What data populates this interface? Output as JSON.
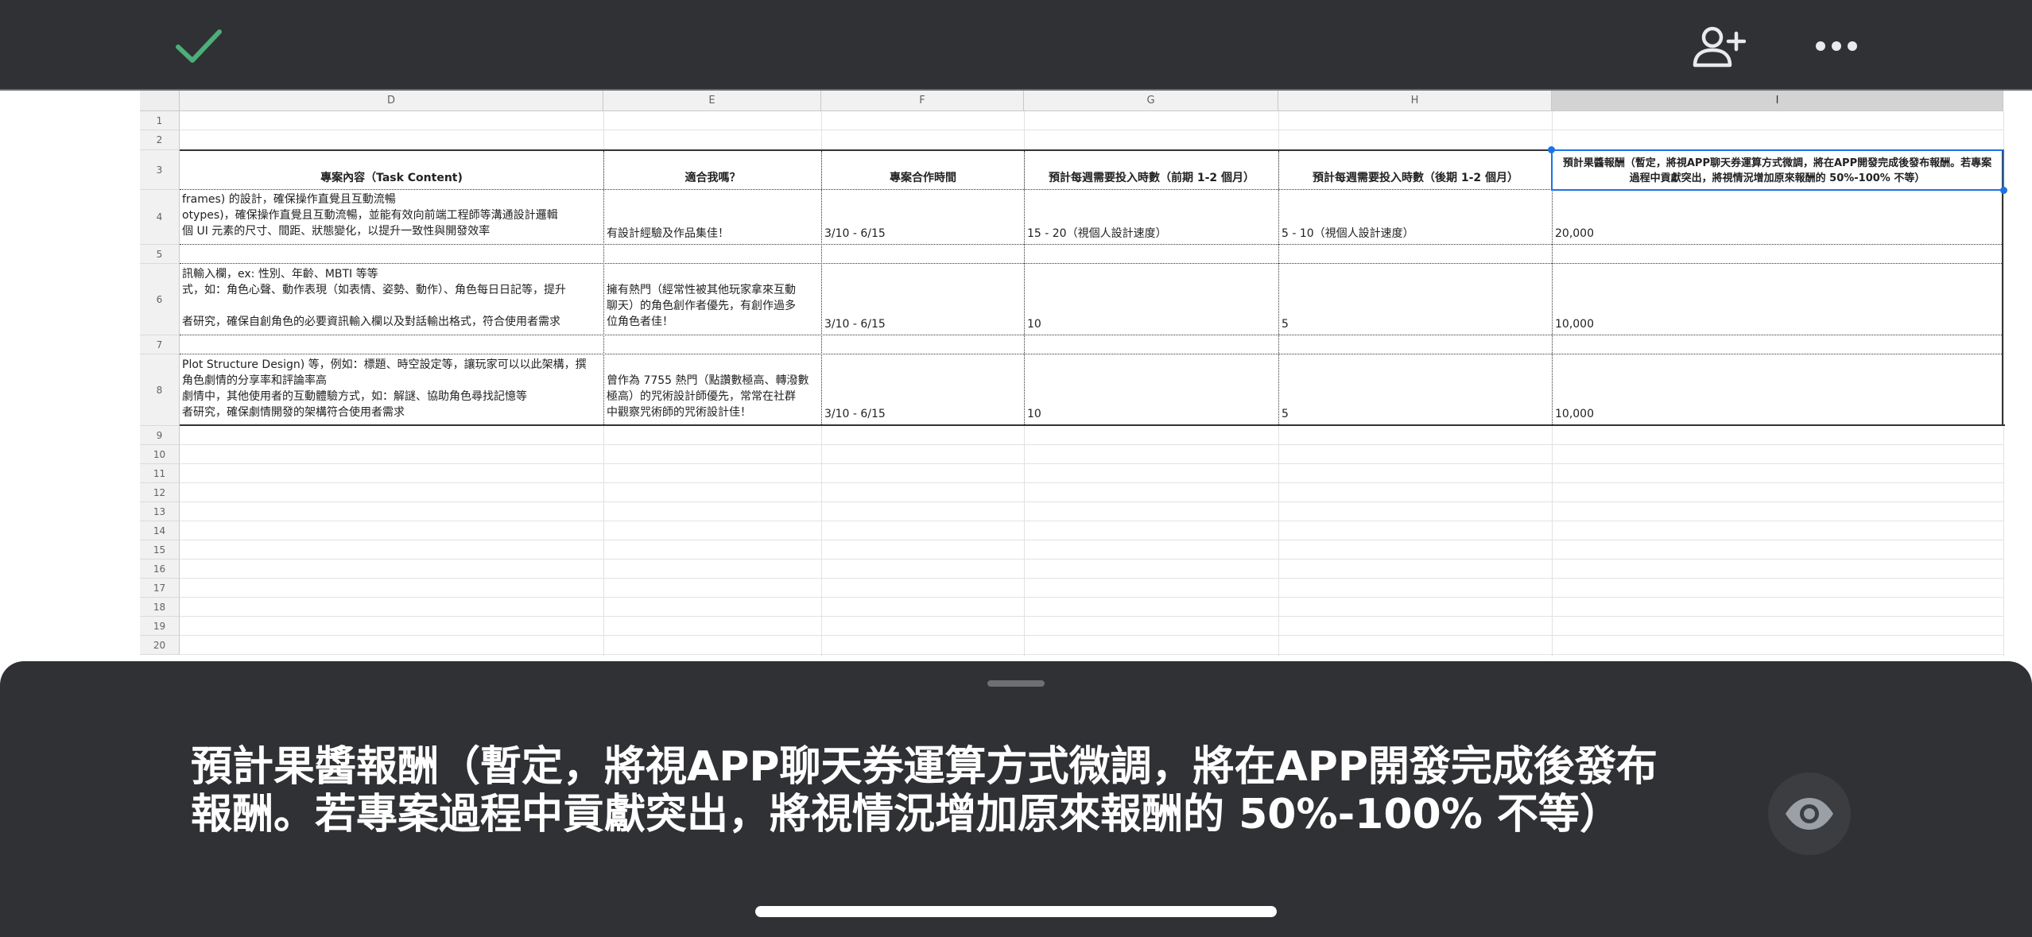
{
  "toolbar": {
    "check_icon": "check-icon",
    "add_user_icon": "person-add-icon",
    "more_icon": "more-horiz-icon"
  },
  "spreadsheet": {
    "columns": [
      "D",
      "E",
      "F",
      "G",
      "H",
      "I"
    ],
    "rows": [
      "1",
      "2",
      "3",
      "4",
      "5",
      "6",
      "7",
      "8",
      "9",
      "10",
      "11",
      "12",
      "13",
      "14",
      "15",
      "16",
      "17",
      "18",
      "19",
      "20"
    ],
    "header_row": {
      "d": "專案內容（Task Content)",
      "e": "適合我嗎？",
      "f": "專案合作時間",
      "g": "預計每週需要投入時數（前期 1-2 個月）",
      "h": "預計每週需要投入時數（後期 1-2 個月）",
      "i": "預計果醬報酬（暫定，將視APP聊天券運算方式微調，將在APP開發完成後發布報酬。若專案過程中貢獻突出，將視情況增加原來報酬的 50%-100% 不等）"
    },
    "row4": {
      "d": [
        "frames) 的設計，確保操作直覺且互動流暢",
        "otypes)，確保操作直覺且互動流暢，並能有效向前端工程師等溝通設計邏輯",
        "個 UI 元素的尺寸、間距、狀態變化，以提升一致性與開發效率"
      ],
      "e": "有設計經驗及作品集佳！",
      "f": "3/10 - 6/15",
      "g": "15 - 20（視個人設計速度）",
      "h": "5 - 10（視個人設計速度）",
      "i": "20,000"
    },
    "row6": {
      "d": [
        "訊輸入欄，ex: 性別、年齡、MBTI 等等",
        "式，如：角色心聲、動作表現（如表情、姿勢、動作）、角色每日日記等，提升",
        "",
        "者研究，確保自創角色的必要資訊輸入欄以及對話輸出格式，符合使用者需求"
      ],
      "e": [
        "擁有熱門（經常性被其他玩家拿來互動",
        "聊天）的角色創作者優先，有創作過多",
        "位角色者佳！"
      ],
      "f": "3/10 - 6/15",
      "g": "10",
      "h": "5",
      "i": "10,000"
    },
    "row8": {
      "d": [
        "Plot Structure Design) 等，例如：標題、時空設定等，讓玩家可以以此架構，撰",
        "角色劇情的分享率和評論率高",
        "劇情中，其他使用者的互動體驗方式，如：解謎、協助角色尋找記憶等",
        "者研究，確保劇情開發的架構符合使用者需求"
      ],
      "e": [
        "曾作為 7755 熱門（點讚數極高、轉潑數",
        "極高）的咒術設計師優先，常常在社群",
        "中觀察咒術師的咒術設計佳！"
      ],
      "f": "3/10 - 6/15",
      "g": "10",
      "h": "5",
      "i": "10,000"
    }
  },
  "preview": {
    "text": "預計果醬報酬（暫定，將視APP聊天券運算方式微調，將在APP開發完成後發布報酬。若專案過程中貢獻突出，將視情況增加原來報酬的 50%-100% 不等）",
    "eye_icon": "eye-icon"
  }
}
